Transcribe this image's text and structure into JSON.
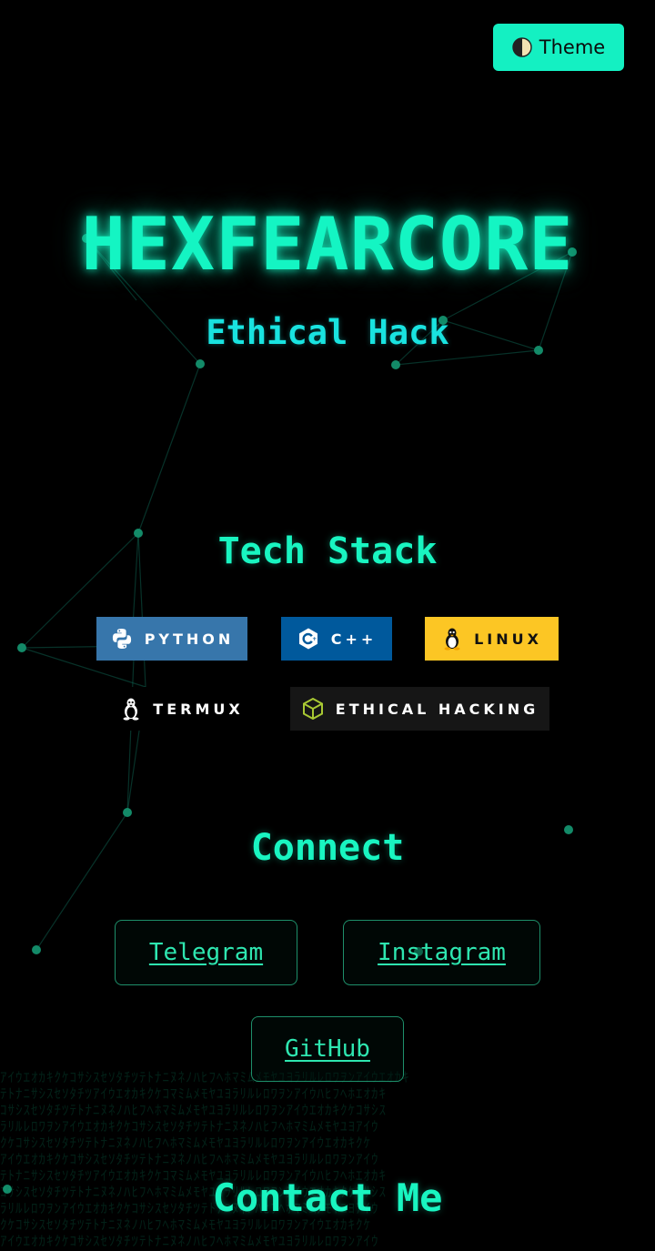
{
  "theme_toggle": {
    "icon": "half-moon-icon",
    "label": "Theme"
  },
  "hero": {
    "title": "HEXFEARCORE",
    "subtitle": "Ethical Hack"
  },
  "tech_stack": {
    "heading": "Tech Stack",
    "badges": [
      {
        "label": "PYTHON",
        "icon": "python-icon",
        "bg": "#3776ab",
        "fg": "#ffffff"
      },
      {
        "label": "C++",
        "icon": "cplusplus-icon",
        "bg": "#00599c",
        "fg": "#ffffff"
      },
      {
        "label": "LINUX",
        "icon": "linux-tux-icon",
        "bg": "#fcc624",
        "fg": "#111111"
      },
      {
        "label": "TERMUX",
        "icon": "linux-tux-icon",
        "bg": "#000000",
        "fg": "#ffffff"
      },
      {
        "label": "ETHICAL HACKING",
        "icon": "cube-icon",
        "bg": "#161616",
        "fg": "#ffffff"
      }
    ]
  },
  "connect": {
    "heading": "Connect",
    "links": [
      {
        "label": "Telegram"
      },
      {
        "label": "Instagram"
      },
      {
        "label": "GitHub"
      }
    ]
  },
  "contact": {
    "heading": "Contact Me"
  },
  "colors": {
    "accent": "#14f0c2",
    "background": "#000000",
    "link_border": "#1e8f6a"
  }
}
